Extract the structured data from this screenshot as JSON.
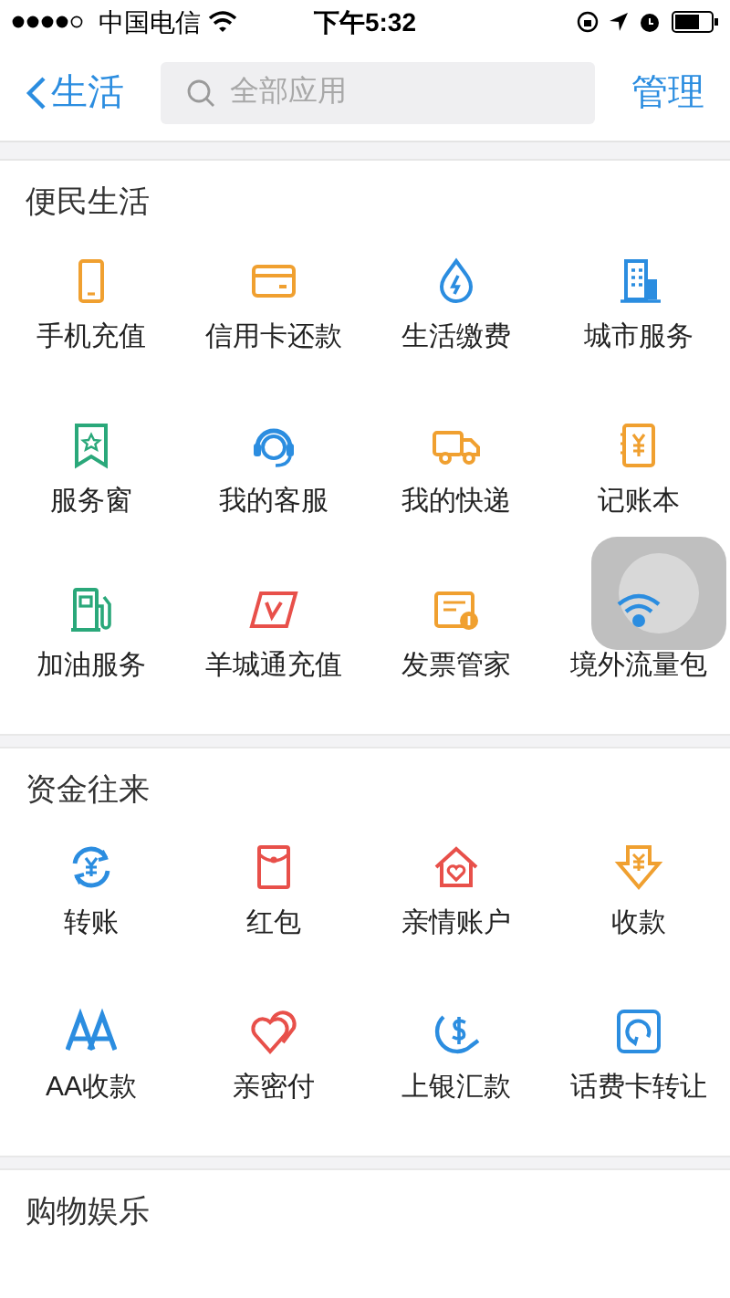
{
  "status_bar": {
    "carrier": "中国电信",
    "time": "下午5:32"
  },
  "nav": {
    "back": "生活",
    "search": {
      "placeholder": "全部应用"
    },
    "action": "管理"
  },
  "sections": [
    {
      "title": "便民生活",
      "items": [
        {
          "label": "手机充值"
        },
        {
          "label": "信用卡还款"
        },
        {
          "label": "生活缴费"
        },
        {
          "label": "城市服务"
        },
        {
          "label": "服务窗"
        },
        {
          "label": "我的客服"
        },
        {
          "label": "我的快递"
        },
        {
          "label": "记账本"
        },
        {
          "label": "加油服务"
        },
        {
          "label": "羊城通充值"
        },
        {
          "label": "发票管家"
        },
        {
          "label": "境外流量包"
        }
      ]
    },
    {
      "title": "资金往来",
      "items": [
        {
          "label": "转账"
        },
        {
          "label": "红包"
        },
        {
          "label": "亲情账户"
        },
        {
          "label": "收款"
        },
        {
          "label": "AA收款"
        },
        {
          "label": "亲密付"
        },
        {
          "label": "上银汇款"
        },
        {
          "label": "话费卡转让"
        }
      ]
    },
    {
      "title": "购物娱乐"
    }
  ]
}
